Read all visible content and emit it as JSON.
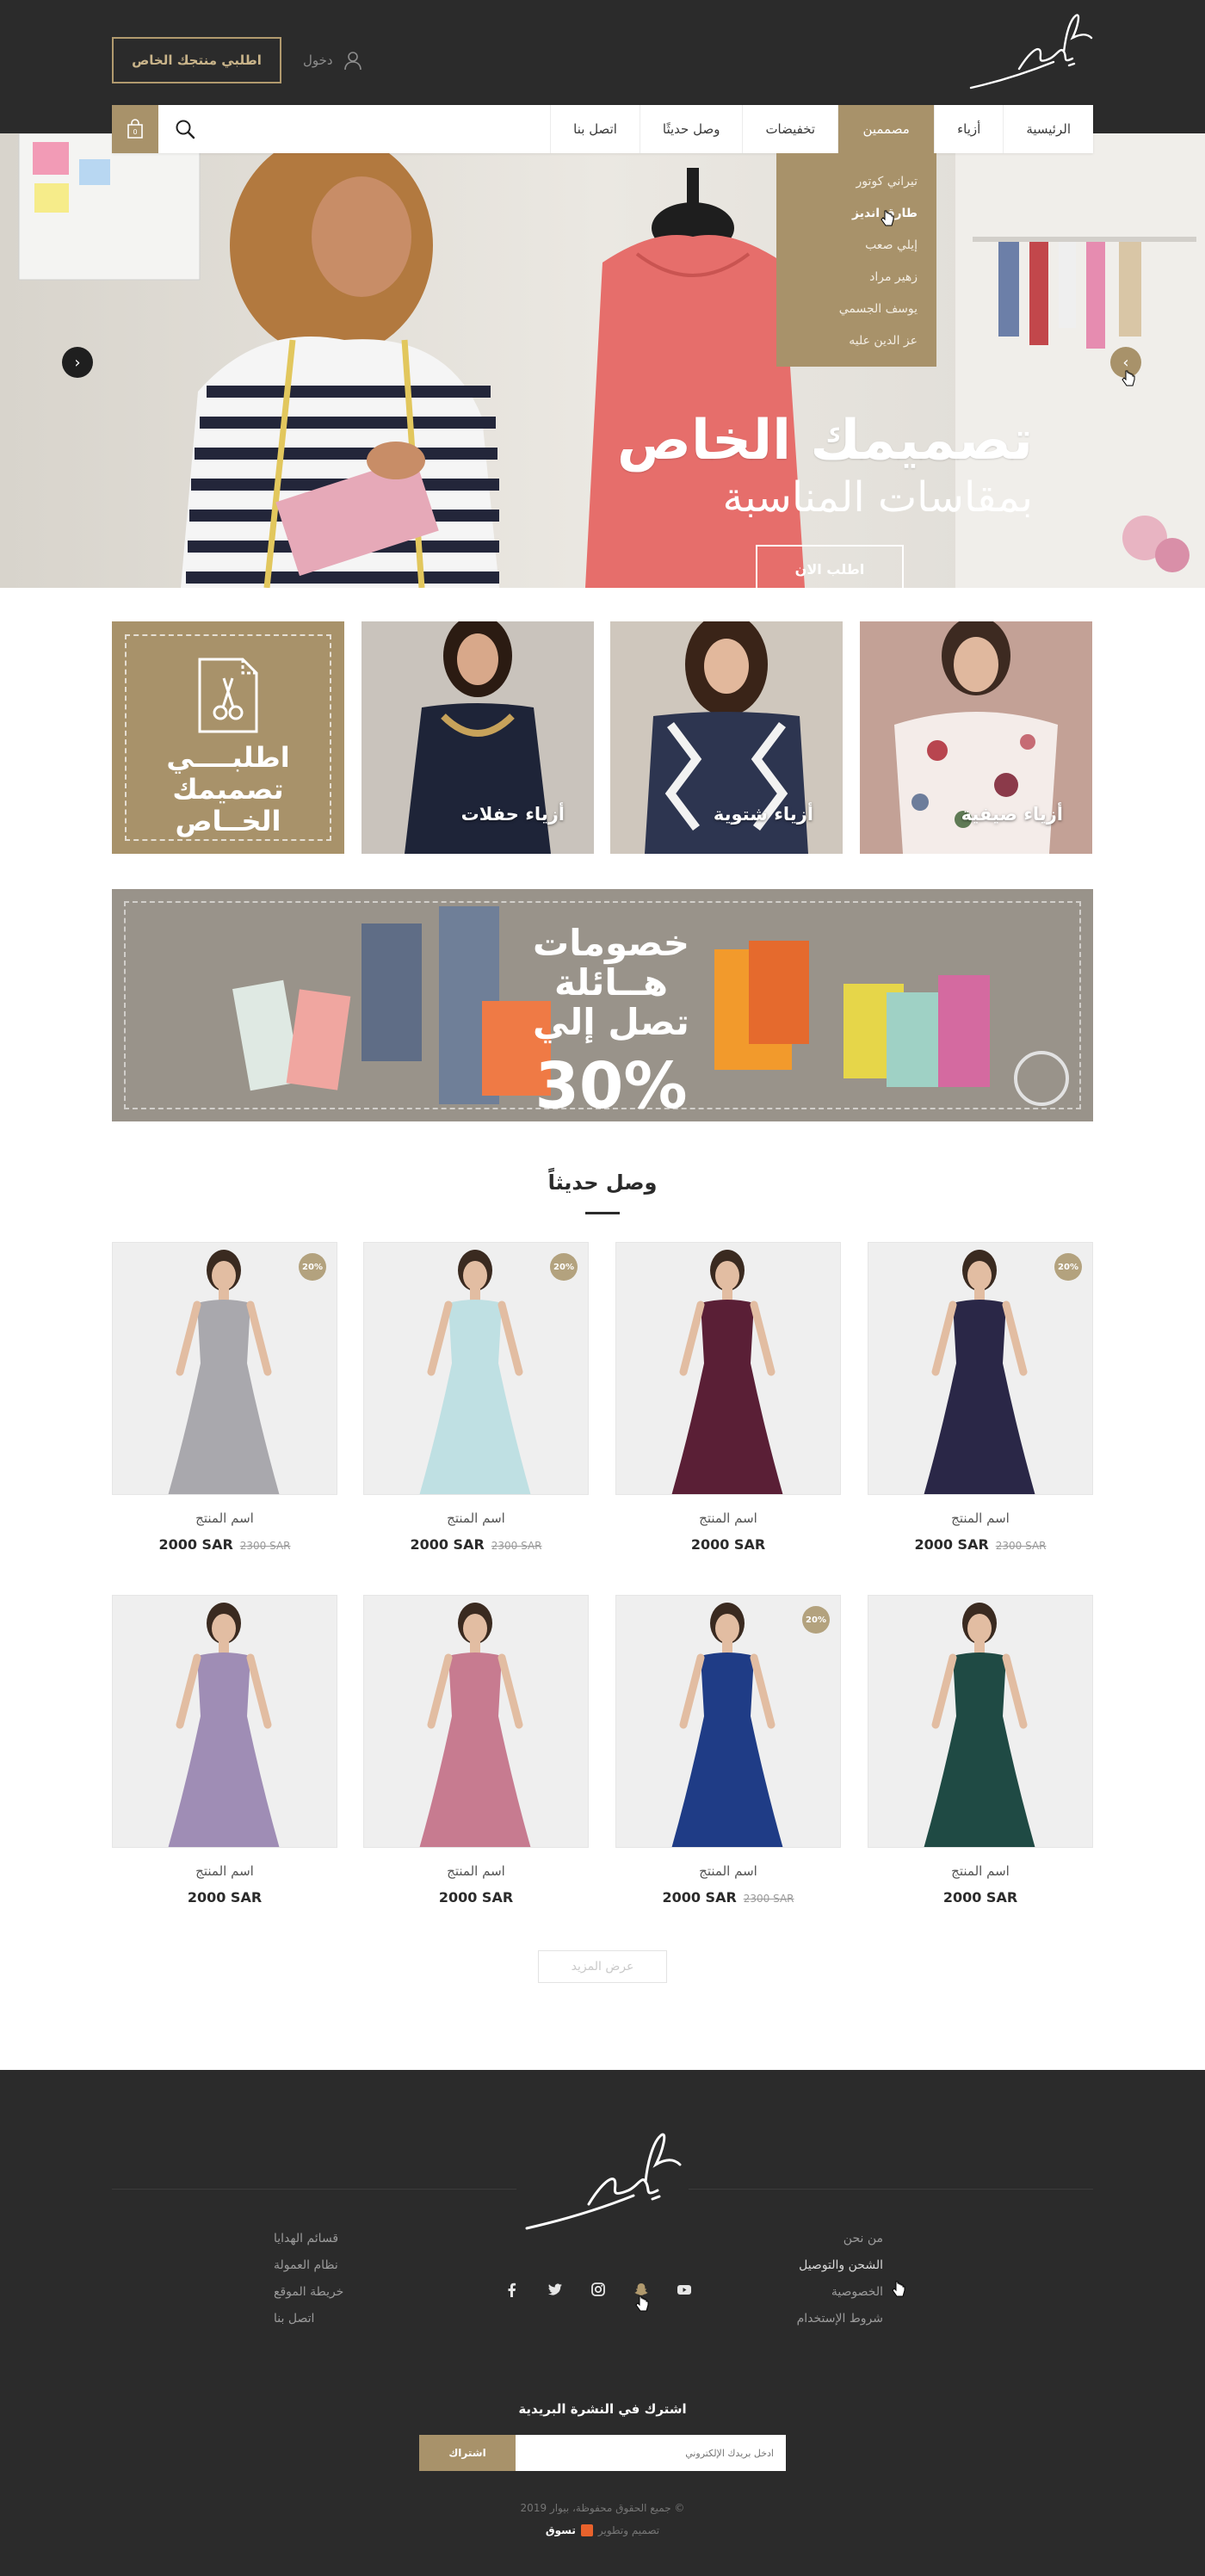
{
  "header": {
    "custom_button": "اطلبي منتجك الخاص",
    "login_label": "دخول"
  },
  "nav": {
    "items": [
      "الرئيسية",
      "أزياء",
      "مصممين",
      "تخفيضات",
      "وصل حديثًا",
      "اتصل بنا"
    ],
    "active": "مصممين",
    "cart_count": "0"
  },
  "dropdown": {
    "items": [
      "تيراني كوتور",
      "طارق انديز",
      "إيلي صعب",
      "زهير مراد",
      "يوسف الجسمي",
      "عز الدين عليه"
    ],
    "hovered": "طارق انديز"
  },
  "hero": {
    "title": "تصميمك الخاص",
    "subtitle": "بمقاسات المناسبة",
    "button": "اطلب الان",
    "slide_count": 3,
    "active_slide": 2
  },
  "categories": [
    {
      "label": "أزياء صيفية",
      "colors": [
        "#c3a196",
        "#f4ece9"
      ]
    },
    {
      "label": "أزياء شتوية",
      "colors": [
        "#2d3550",
        "#cfc7bd"
      ]
    },
    {
      "label": "أزياء حفلات",
      "colors": [
        "#1e2438",
        "#c9c3bc"
      ]
    }
  ],
  "design_tile": {
    "lines": [
      "اطلبــــي",
      "تصميمك",
      "الخــاص"
    ]
  },
  "promo": {
    "lines": [
      "خصومات",
      "هــائلة",
      "تصل إلي"
    ],
    "percent": "30%"
  },
  "new_arrivals": {
    "title": "وصل حديثاً",
    "products": [
      {
        "name": "اسم المنتج",
        "price": "2000 SAR",
        "old_price": "2300 SAR",
        "badge": "20%",
        "dress": "#2a2747"
      },
      {
        "name": "اسم المنتج",
        "price": "2000 SAR",
        "old_price": "",
        "badge": "",
        "dress": "#5a1f36"
      },
      {
        "name": "اسم المنتج",
        "price": "2000 SAR",
        "old_price": "2300 SAR",
        "badge": "20%",
        "dress": "#bfe0e3"
      },
      {
        "name": "اسم المنتج",
        "price": "2000 SAR",
        "old_price": "2300 SAR",
        "badge": "20%",
        "dress": "#a9a8ad"
      },
      {
        "name": "اسم المنتج",
        "price": "2000 SAR",
        "old_price": "",
        "badge": "",
        "dress": "#1f4a44"
      },
      {
        "name": "اسم المنتج",
        "price": "2000 SAR",
        "old_price": "2300 SAR",
        "badge": "20%",
        "dress": "#1f3c86"
      },
      {
        "name": "اسم المنتج",
        "price": "2000 SAR",
        "old_price": "",
        "badge": "",
        "dress": "#c77b90"
      },
      {
        "name": "اسم المنتج",
        "price": "2000 SAR",
        "old_price": "",
        "badge": "",
        "dress": "#9f8db5"
      }
    ],
    "more_button": "عرض المزيد"
  },
  "footer": {
    "col_right": [
      "من نحن",
      "الشحن والتوصيل",
      "الخصوصية",
      "شروط الإستخدام"
    ],
    "col_right_hover": "الشحن والتوصيل",
    "col_left": [
      "قسائم الهدايا",
      "نظام العمولة",
      "خريطة الموقع",
      "اتصل بنا"
    ],
    "social": [
      "youtube-icon",
      "snapchat-icon",
      "instagram-icon",
      "twitter-icon",
      "facebook-icon"
    ],
    "newsletter_title": "اشترك في النشرة البريدية",
    "newsletter_placeholder": "ادخل بريدك الإلكتروني",
    "newsletter_button": "اشتراك",
    "copyright": "© جميع الحقوق محفوظة، بيوار 2019",
    "credits_text": "تصميم وتطوير",
    "credits_brand": "تسوق"
  },
  "colors": {
    "accent": "#a8926a",
    "dark": "#2b2b2b"
  }
}
